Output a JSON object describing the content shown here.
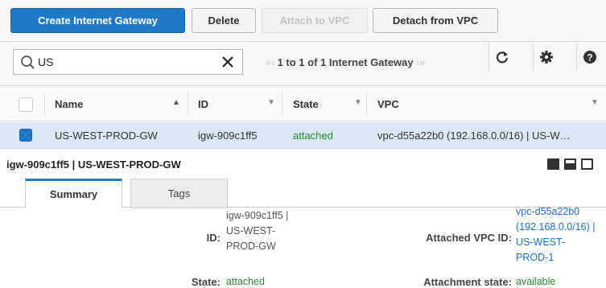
{
  "toolbar": {
    "create_label": "Create Internet Gateway",
    "delete_label": "Delete",
    "attach_label": "Attach to VPC",
    "detach_label": "Detach from VPC"
  },
  "search": {
    "value": "US",
    "pager_text": "1 to 1 of 1 Internet Gateway"
  },
  "icons": {
    "search": "search-icon",
    "clear": "close-icon",
    "refresh": "refresh-icon",
    "settings": "gear-icon",
    "help": "help-icon"
  },
  "table": {
    "columns": [
      "Name",
      "ID",
      "State",
      "VPC"
    ],
    "rows": [
      {
        "name": "US-WEST-PROD-GW",
        "id": "igw-909c1ff5",
        "state": "attached",
        "vpc": "vpc-d55a22b0 (192.168.0.0/16) | US-W…"
      }
    ]
  },
  "detail": {
    "title": "igw-909c1ff5 | US-WEST-PROD-GW",
    "tabs": [
      "Summary",
      "Tags"
    ],
    "id_label": "ID:",
    "id_value_lines": [
      "igw-909c1ff5 |",
      "US-WEST-",
      "PROD-GW"
    ],
    "state_label": "State:",
    "state_value": "attached",
    "attached_vpc_label": "Attached VPC ID:",
    "attached_vpc_lines": [
      "vpc-d55a22b0",
      "(192.168.0.0/16) |",
      "US-WEST-",
      "PROD-1"
    ],
    "attachment_state_label": "Attachment state:",
    "attachment_state_value": "available"
  },
  "colors": {
    "primary": "#1f78c8",
    "selected_row": "#d8e8f7",
    "status_green": "#2a8a2a",
    "link": "#1f6fc4"
  }
}
